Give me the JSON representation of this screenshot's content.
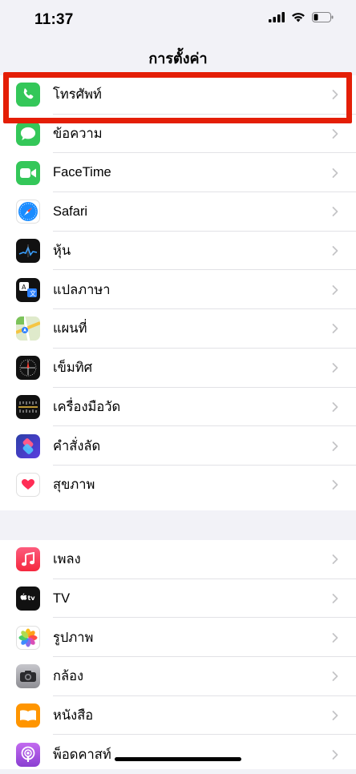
{
  "status": {
    "time": "11:37"
  },
  "header": {
    "title": "การตั้งค่า"
  },
  "group1": [
    {
      "label": "โทรศัพท์",
      "icon": "phone-icon",
      "color": "#34c759"
    },
    {
      "label": "ข้อความ",
      "icon": "messages-icon",
      "color": "#34c759"
    },
    {
      "label": "FaceTime",
      "icon": "facetime-icon",
      "color": "#34c759"
    },
    {
      "label": "Safari",
      "icon": "safari-icon",
      "color": "#1a8cff"
    },
    {
      "label": "หุ้น",
      "icon": "stocks-icon",
      "color": "#111111"
    },
    {
      "label": "แปลภาษา",
      "icon": "translate-icon",
      "color": "#111111"
    },
    {
      "label": "แผนที่",
      "icon": "maps-icon",
      "color": "#6cc04a"
    },
    {
      "label": "เข็มทิศ",
      "icon": "compass-icon",
      "color": "#111111"
    },
    {
      "label": "เครื่องมือวัด",
      "icon": "measure-icon",
      "color": "#111111"
    },
    {
      "label": "คำสั่งลัด",
      "icon": "shortcuts-icon",
      "color": "#5b3ee0"
    },
    {
      "label": "สุขภาพ",
      "icon": "health-icon",
      "color": "#ffffff"
    }
  ],
  "group2": [
    {
      "label": "เพลง",
      "icon": "music-icon",
      "color": "#fa3d55"
    },
    {
      "label": "TV",
      "icon": "tv-icon",
      "color": "#111111"
    },
    {
      "label": "รูปภาพ",
      "icon": "photos-icon",
      "color": "#ffffff"
    },
    {
      "label": "กล้อง",
      "icon": "camera-icon",
      "color": "#8e8e93"
    },
    {
      "label": "หนังสือ",
      "icon": "books-icon",
      "color": "#ff9500"
    },
    {
      "label": "พ็อดคาสท์",
      "icon": "podcasts-icon",
      "color": "#9b4fd8"
    }
  ],
  "highlight": {
    "color": "#e41e06",
    "target": "โทรศัพท์"
  }
}
